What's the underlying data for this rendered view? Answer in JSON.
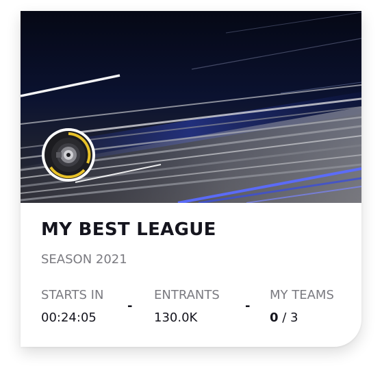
{
  "league": {
    "title": "MY BEST LEAGUE",
    "season": "SEASON 2021"
  },
  "stats": {
    "starts_in": {
      "label": "STARTS IN",
      "value": "00:24:05"
    },
    "entrants": {
      "label": "ENTRANTS",
      "value": "130.0K"
    },
    "my_teams": {
      "label": "MY TEAMS",
      "current": "0",
      "rest": " / 3"
    },
    "separator": "-"
  },
  "badge": {
    "icon": "wheel-icon",
    "accent": "#e8c229"
  },
  "colors": {
    "text_primary": "#15151e",
    "text_secondary": "#7a7a80",
    "hero_bg": "#050916",
    "streak_blue": "#5b6cff"
  }
}
